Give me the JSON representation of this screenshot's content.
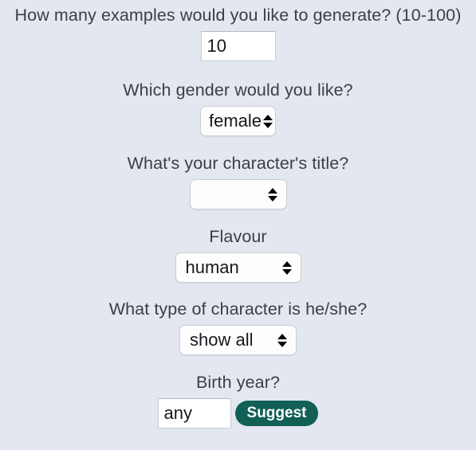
{
  "form": {
    "background_color": "#e3e7ef",
    "accent_color": "#125f56",
    "fields": [
      {
        "label": "How many examples would you like to generate? (10-100)",
        "control": "number-input",
        "value": "10"
      },
      {
        "label": "Which gender would you like?",
        "control": "select",
        "value": "female"
      },
      {
        "label": "What's your character's title?",
        "control": "select",
        "value": ""
      },
      {
        "label": "Flavour",
        "control": "select",
        "value": "human"
      },
      {
        "label": "What type of character is he/she?",
        "control": "select",
        "value": "show all"
      },
      {
        "label": "Birth year?",
        "control": "text-input",
        "value": "any"
      }
    ],
    "suggest_button_label": "Suggest"
  }
}
